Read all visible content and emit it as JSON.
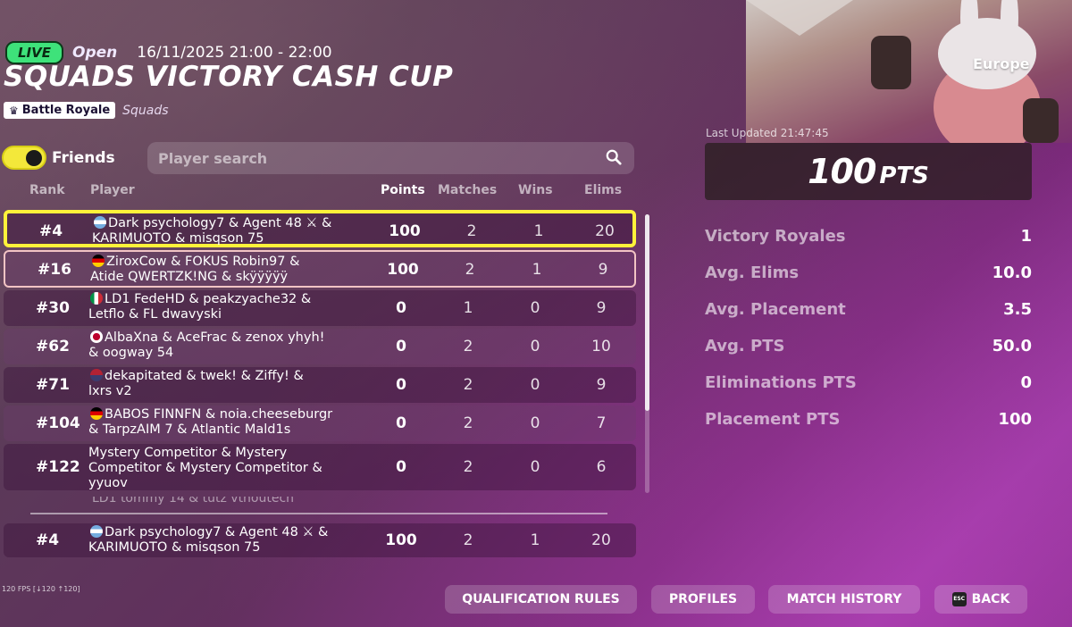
{
  "header": {
    "live": "LIVE",
    "status": "Open",
    "datetime": "16/11/2025 21:00 - 22:00",
    "title": "SQUADS VICTORY CASH CUP",
    "mode_tag": "Battle Royale",
    "mode_sub": "Squads"
  },
  "filters": {
    "friends_label": "Friends",
    "friends_on": true,
    "search_placeholder": "Player search"
  },
  "columns": {
    "rank": "Rank",
    "player": "Player",
    "points": "Points",
    "matches": "Matches",
    "wins": "Wins",
    "elims": "Elims"
  },
  "rows": [
    {
      "rank": "#4",
      "line1": "Dark psychology7 & Agent 48 ⚔ &",
      "line2": "KARIMUOTO & misqson 75",
      "points": "100",
      "matches": "2",
      "wins": "1",
      "elims": "20"
    },
    {
      "rank": "#16",
      "line1": "ZiroxCow & FOKUS Robin97 &",
      "line2": "Atide QWERTZK!NG & skÿÿÿÿÿ",
      "points": "100",
      "matches": "2",
      "wins": "1",
      "elims": "9"
    },
    {
      "rank": "#30",
      "line1": "LD1 FedeHD & peakzyache32 &",
      "line2": "Letflo & FL dwavyski",
      "points": "0",
      "matches": "1",
      "wins": "0",
      "elims": "9"
    },
    {
      "rank": "#62",
      "line1": "AlbaXna & AceFrac & zenox yhyh!",
      "line2": "& oogway 54",
      "points": "0",
      "matches": "2",
      "wins": "0",
      "elims": "10"
    },
    {
      "rank": "#71",
      "line1": "dekapitated & twek! & Ziffy! &",
      "line2": "lxrs v2",
      "points": "0",
      "matches": "2",
      "wins": "0",
      "elims": "9"
    },
    {
      "rank": "#104",
      "line1": "BABOS FINNFN & noia.cheeseburgr",
      "line2": "& TarpzAIM 7 & Atlantic Mald1s",
      "points": "0",
      "matches": "2",
      "wins": "0",
      "elims": "7"
    },
    {
      "rank": "#122",
      "line1": "Mystery Competitor & Mystery",
      "line2": "Competitor & Mystery Competitor &",
      "line3": "yyuov",
      "points": "0",
      "matches": "2",
      "wins": "0",
      "elims": "6"
    }
  ],
  "partial_row": "LD1 tommy 14 & tutz vtnoutech",
  "pinned_row": {
    "rank": "#4",
    "line1": "Dark psychology7 & Agent 48 ⚔ &",
    "line2": "KARIMUOTO & misqson 75",
    "points": "100",
    "matches": "2",
    "wins": "1",
    "elims": "20"
  },
  "panel": {
    "region": "Europe",
    "last_updated": "Last Updated 21:47:45",
    "total_pts": "100",
    "total_pts_unit": "PTS",
    "stats": [
      {
        "label": "Victory Royales",
        "value": "1"
      },
      {
        "label": "Avg. Elims",
        "value": "10.0"
      },
      {
        "label": "Avg. Placement",
        "value": "3.5"
      },
      {
        "label": "Avg. PTS",
        "value": "50.0"
      },
      {
        "label": "Eliminations PTS",
        "value": "0"
      },
      {
        "label": "Placement PTS",
        "value": "100"
      }
    ]
  },
  "footer": {
    "fps": "120 FPS [↓120 ↑120]",
    "qualification": "QUALIFICATION RULES",
    "profiles": "PROFILES",
    "history": "MATCH HISTORY",
    "back": "BACK",
    "esc": "ESC"
  },
  "colors": {
    "live": "#3ee27a",
    "toggle": "#f3e83a",
    "selected_border": "#fff23a"
  }
}
